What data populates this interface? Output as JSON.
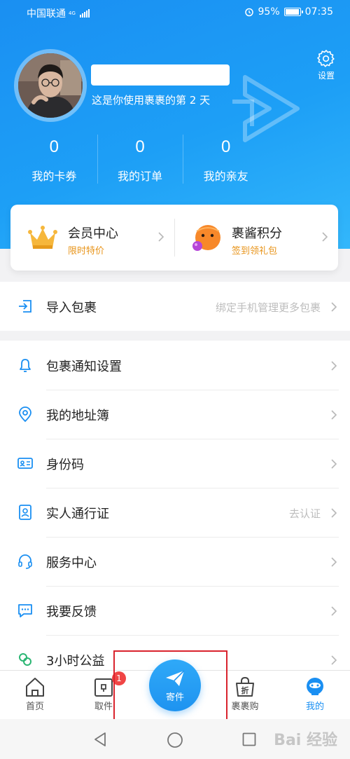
{
  "status_bar": {
    "carrier": "中国联通",
    "network": "4G",
    "battery": "95%",
    "battery_level": 0.95,
    "time": "07:35"
  },
  "header": {
    "settings_label": "设置",
    "tagline": "这是你使用裹裹的第 2 天"
  },
  "stats": [
    {
      "value": "0",
      "label": "我的卡券"
    },
    {
      "value": "0",
      "label": "我的订单"
    },
    {
      "value": "0",
      "label": "我的亲友"
    }
  ],
  "member": {
    "vip": {
      "title": "会员中心",
      "subtitle": "限时特价"
    },
    "points": {
      "title": "裹酱积分",
      "subtitle": "签到领礼包"
    }
  },
  "import_row": {
    "label": "导入包裹",
    "hint": "绑定手机管理更多包裹"
  },
  "menu": [
    {
      "label": "包裹通知设置",
      "hint": ""
    },
    {
      "label": "我的地址簿",
      "hint": ""
    },
    {
      "label": "身份码",
      "hint": ""
    },
    {
      "label": "实人通行证",
      "hint": "去认证"
    },
    {
      "label": "服务中心",
      "hint": ""
    },
    {
      "label": "我要反馈",
      "hint": ""
    },
    {
      "label": "3小时公益",
      "hint": ""
    }
  ],
  "tabs": {
    "home": "首页",
    "pickup": "取件",
    "send": "寄件",
    "shop": "裹裹购",
    "mine": "我的"
  },
  "pickup_badge": "1",
  "shop_icon_char": "折",
  "watermark": "Bai 经验",
  "colors": {
    "primary": "#1a8ff2",
    "accent_orange": "#e8941a",
    "badge_red": "#f04545",
    "highlight_red": "#d9232d"
  }
}
